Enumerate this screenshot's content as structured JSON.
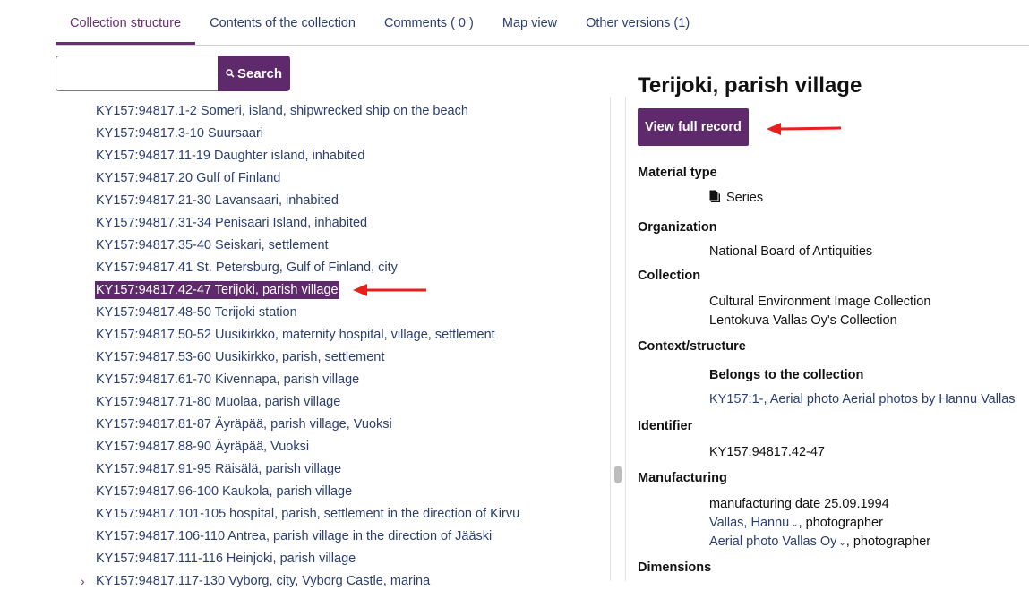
{
  "tabs": [
    {
      "label": "Collection structure",
      "active": true
    },
    {
      "label": "Contents of the collection"
    },
    {
      "label": "Comments ( 0 )"
    },
    {
      "label": "Map view"
    },
    {
      "label": "Other versions (1)"
    }
  ],
  "search": {
    "value": "",
    "button_label": "Search",
    "icon": "search-icon"
  },
  "tree": {
    "items": [
      "KY157:94817.1-2 Someri, island, shipwrecked ship on the beach",
      "KY157:94817.3-10 Suursaari",
      "KY157:94817.11-19 Daughter island, inhabited",
      "KY157:94817.20 Gulf of Finland",
      "KY157:94817.21-30 Lavansaari, inhabited",
      "KY157:94817.31-34 Penisaari Island, inhabited",
      "KY157:94817.35-40 Seiskari, settlement",
      "KY157:94817.41 St. Petersburg, Gulf of Finland, city",
      "KY157:94817.42-47 Terijoki, parish village",
      "KY157:94817.48-50 Terijoki station",
      "KY157:94817.50-52 Uusikirkko, maternity hospital, village, settlement",
      "KY157:94817.53-60 Uusikirkko, parish, settlement",
      "KY157:94817.61-70 Kivennapa, parish village",
      "KY157:94817.71-80 Muolaa, parish village",
      "KY157:94817.81-87 Äyräpää, parish village, Vuoksi",
      "KY157:94817.88-90 Äyräpää, Vuoksi",
      "KY157:94817.91-95 Räisälä, parish village",
      "KY157:94817.96-100 Kaukola, parish village",
      "KY157:94817.101-105 hospital, parish, settlement in the direction of Kirvu",
      "KY157:94817.106-110 Antrea, parish village in the direction of Jääski",
      "KY157:94817.111-116 Heinjoki, parish village",
      "KY157:94817.117-130 Vyborg, city, Vyborg Castle, marina"
    ],
    "selected_index": 8
  },
  "record": {
    "title": "Terijoki, parish village",
    "view_button": "View full record",
    "material_type_label": "Material type",
    "material_type": "Series",
    "organization_label": "Organization",
    "organization": "National Board of Antiquities",
    "collection_label": "Collection",
    "collections": [
      "Cultural Environment Image Collection",
      "Lentokuva Vallas Oy's Collection"
    ],
    "context_label": "Context/structure",
    "belongs_label": "Belongs to the collection",
    "belongs_link": "KY157:1-, Aerial photo Aerial photos by Hannu Vallas",
    "identifier_label": "Identifier",
    "identifier": "KY157:94817.42-47",
    "manufacturing_label": "Manufacturing",
    "manufacturing_date": "manufacturing date 25.09.1994",
    "makers": [
      {
        "name": "Vallas, Hannu",
        "role": ", photographer"
      },
      {
        "name": "Aerial photo Vallas Oy",
        "role": ", photographer"
      }
    ],
    "dimensions_label": "Dimensions"
  },
  "colors": {
    "accent": "#5e2a6b",
    "link": "#2c3e70",
    "annotation_arrow": "#e8201c"
  }
}
